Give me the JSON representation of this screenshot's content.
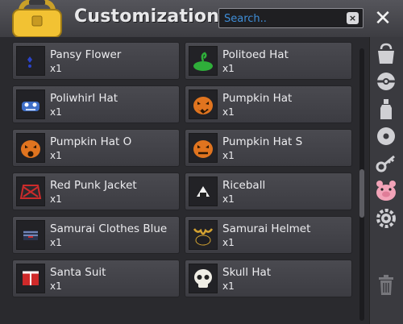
{
  "window": {
    "title": "Customizations"
  },
  "search": {
    "placeholder": "Search..",
    "clear_label": "×"
  },
  "close_label": "✕",
  "items": [
    {
      "name": "Pansy Flower",
      "qty": "x1",
      "icon": "pansy-flower-icon"
    },
    {
      "name": "Politoed Hat",
      "qty": "x1",
      "icon": "politoed-hat-icon"
    },
    {
      "name": "Poliwhirl Hat",
      "qty": "x1",
      "icon": "poliwhirl-hat-icon"
    },
    {
      "name": "Pumpkin Hat",
      "qty": "x1",
      "icon": "pumpkin-hat-icon"
    },
    {
      "name": "Pumpkin Hat O",
      "qty": "x1",
      "icon": "pumpkin-hat-o-icon"
    },
    {
      "name": "Pumpkin Hat S",
      "qty": "x1",
      "icon": "pumpkin-hat-s-icon"
    },
    {
      "name": "Red Punk Jacket",
      "qty": "x1",
      "icon": "red-punk-jacket-icon"
    },
    {
      "name": "Riceball",
      "qty": "x1",
      "icon": "riceball-icon"
    },
    {
      "name": "Samurai Clothes Blue",
      "qty": "x1",
      "icon": "samurai-clothes-blue-icon"
    },
    {
      "name": "Samurai Helmet",
      "qty": "x1",
      "icon": "samurai-helmet-icon"
    },
    {
      "name": "Santa Suit",
      "qty": "x1",
      "icon": "santa-suit-icon"
    },
    {
      "name": "Skull Hat",
      "qty": "x1",
      "icon": "skull-hat-icon"
    }
  ],
  "sidebar": [
    "bag-icon",
    "pokeball-icon",
    "bottle-icon",
    "disc-icon",
    "key-icon",
    "pig-icon",
    "gear-icon",
    "trash-icon"
  ]
}
